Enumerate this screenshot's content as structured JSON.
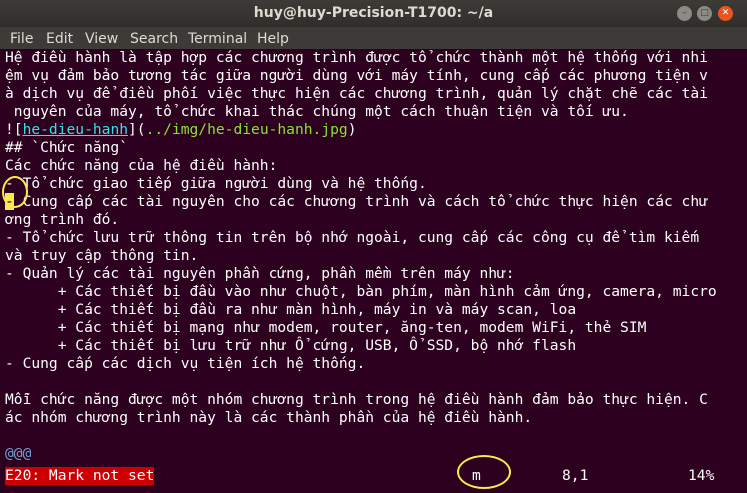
{
  "window": {
    "title": "huy@huy-Precision-T1700: ~/a",
    "btn_min": "–",
    "btn_max": "□",
    "btn_close": "✕"
  },
  "menu": [
    "File",
    "Edit",
    "View",
    "Search",
    "Terminal",
    "Help"
  ],
  "lines": {
    "l1": "Hệ điều hành là tập hợp các chương trình được tổ chức thành một hệ thống với nhi",
    "l2": "ệm vụ đảm bảo tương tác giữa người dùng với máy tính, cung cấp các phương tiện v",
    "l3": "à dịch vụ để điều phối việc thực hiện các chương trình, quản lý chặt chẽ các tài",
    "l4": " nguyên của máy, tổ chức khai thác chúng một cách thuận tiện và tối ưu.",
    "l5_a": "![",
    "l5_link": "he-dieu-hanh",
    "l5_b": "](",
    "l5_path": "../img/he-dieu-hanh.jpg",
    "l5_c": ")",
    "l6": "## `Chức năng`",
    "l7": "Các chức năng của hệ điều hành:",
    "l8": "- Tổ chức giao tiếp giữa người dùng và hệ thống.",
    "l9_cursor": "-",
    "l9_rest": " Cung cấp các tài nguyên cho các chương trình và cách tổ chức thực hiện các chư",
    "l10": "ơng trình đó.",
    "l11": "- Tổ chức lưu trữ thông tin trên bộ nhớ ngoài, cung cấp các công cụ để tìm kiếm",
    "l12": "và truy cập thông tin.",
    "l13": "- Quản lý các tài nguyên phần cứng, phần mềm trên máy như:",
    "l14": "      + Các thiết bị đầu vào như chuột, bàn phím, màn hình cảm ứng, camera, micro",
    "l15": "      + Các thiết bị đầu ra như màn hình, máy in và máy scan, loa",
    "l16": "      + Các thiết bị mạng như modem, router, ăng-ten, modem WiFi, thẻ SIM",
    "l17": "      + Các thiết bị lưu trữ như Ổ cứng, USB, Ổ SSD, bộ nhớ flash",
    "l18": "- Cung cấp các dịch vụ tiện ích hệ thống.",
    "l19": "",
    "l20": "Mỗi chức năng được một nhóm chương trình trong hệ điều hành đảm bảo thực hiện. C",
    "l21": "ác nhóm chương trình này là các thành phần của hệ điều hành.",
    "l22": "",
    "l23": "@@@"
  },
  "status": {
    "error": "E20: Mark not set",
    "pending": "m",
    "position": "8,1",
    "percent": "14%"
  }
}
